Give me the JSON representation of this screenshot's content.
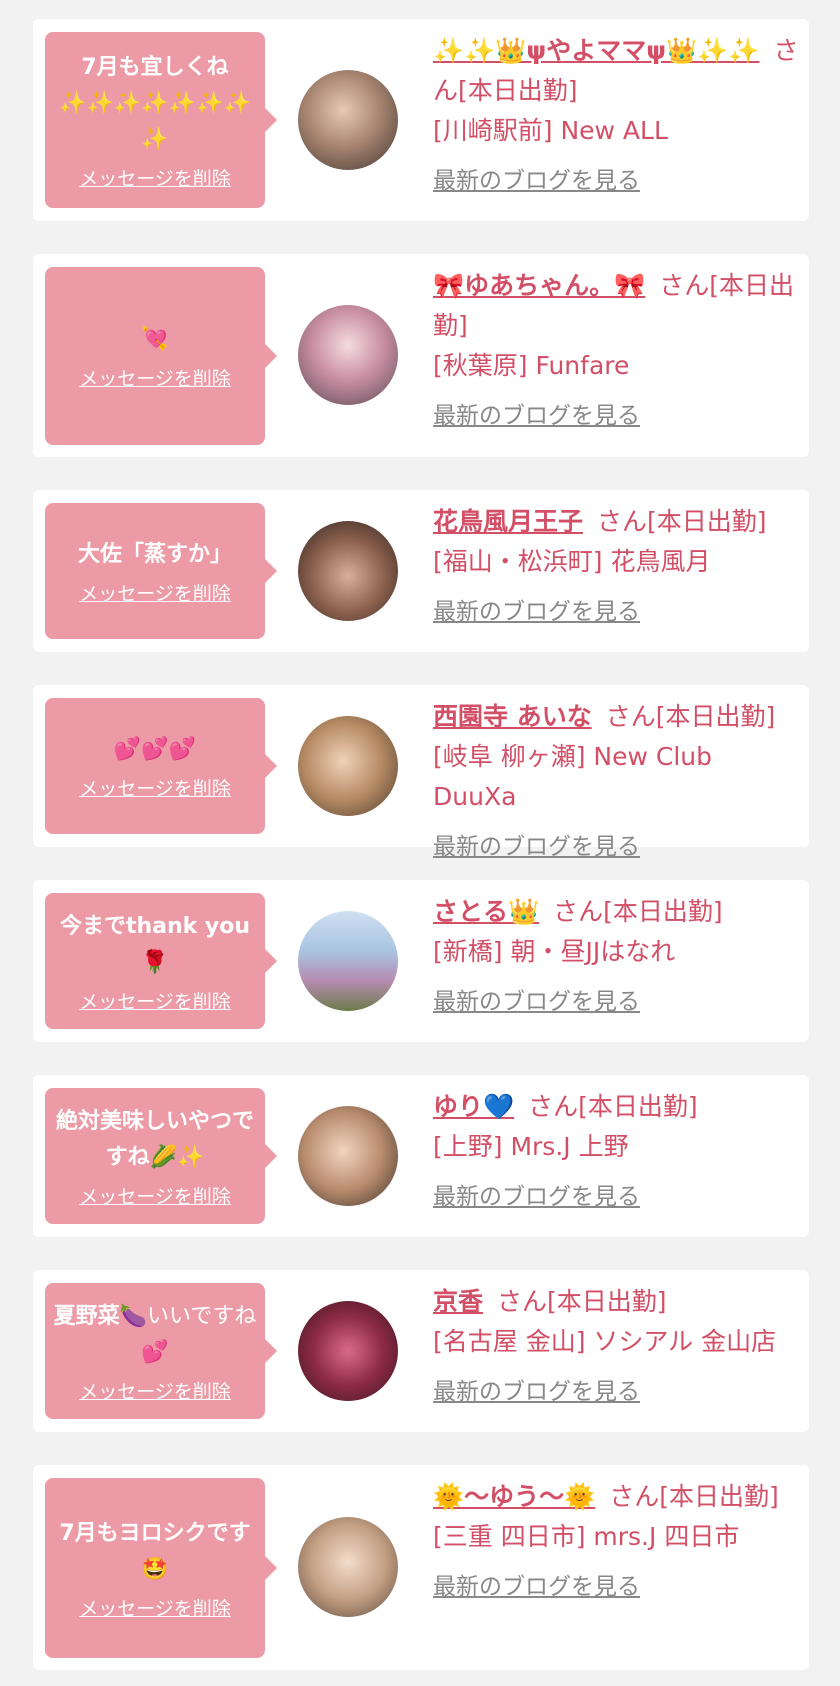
{
  "items": [
    {
      "message": "7月も宜しくね",
      "message_emoji": "✨✨✨✨✨✨✨✨",
      "delete_label": "メッセージを削除",
      "name": "✨✨👑ψやよママψ👑✨✨",
      "suffix": "さん[本日出勤]",
      "shop": "[川崎駅前] New ALL",
      "blog_label": "最新のブログを見る"
    },
    {
      "message": "",
      "message_emoji": "💘",
      "delete_label": "メッセージを削除",
      "name": "🎀ゆあちゃん。🎀",
      "suffix": "さん[本日出勤]",
      "shop": "[秋葉原] Funfare",
      "blog_label": "最新のブログを見る"
    },
    {
      "message": "大佐「蒸すか」",
      "message_emoji": "",
      "delete_label": "メッセージを削除",
      "name": "花鳥風月王子",
      "suffix": "さん[本日出勤]",
      "shop": "[福山・松浜町] 花鳥風月",
      "blog_label": "最新のブログを見る"
    },
    {
      "message": "",
      "message_emoji": "💕💕💕",
      "delete_label": "メッセージを削除",
      "name": "西園寺 あいな",
      "suffix": "さん[本日出勤]",
      "shop": "[岐阜 柳ヶ瀬] New Club DuuXa",
      "blog_label": "最新のブログを見る"
    },
    {
      "message": "今までthank you",
      "message_emoji": "🌹",
      "delete_label": "メッセージを削除",
      "name": "さとる👑",
      "suffix": "さん[本日出勤]",
      "shop": "[新橋] 朝・昼JJはなれ",
      "blog_label": "最新のブログを見る"
    },
    {
      "message": "絶対美味しいやつですね",
      "message_emoji": "🌽✨",
      "delete_label": "メッセージを削除",
      "name": "ゆり💙",
      "suffix": "さん[本日出勤]",
      "shop": "[上野] Mrs.J 上野",
      "blog_label": "最新のブログを見る"
    },
    {
      "message": "夏野菜",
      "message_emoji": "🍆いいですね💕",
      "delete_label": "メッセージを削除",
      "name": "京香",
      "suffix": "さん[本日出勤]",
      "shop": "[名古屋 金山] ソシアル 金山店",
      "blog_label": "最新のブログを見る"
    },
    {
      "message": "7月もヨロシクです",
      "message_emoji": "🤩",
      "delete_label": "メッセージを削除",
      "name": "🌞〜ゆう〜🌞",
      "suffix": "さん[本日出勤]",
      "shop": "[三重 四日市] mrs.J 四日市",
      "blog_label": "最新のブログを見る"
    }
  ]
}
